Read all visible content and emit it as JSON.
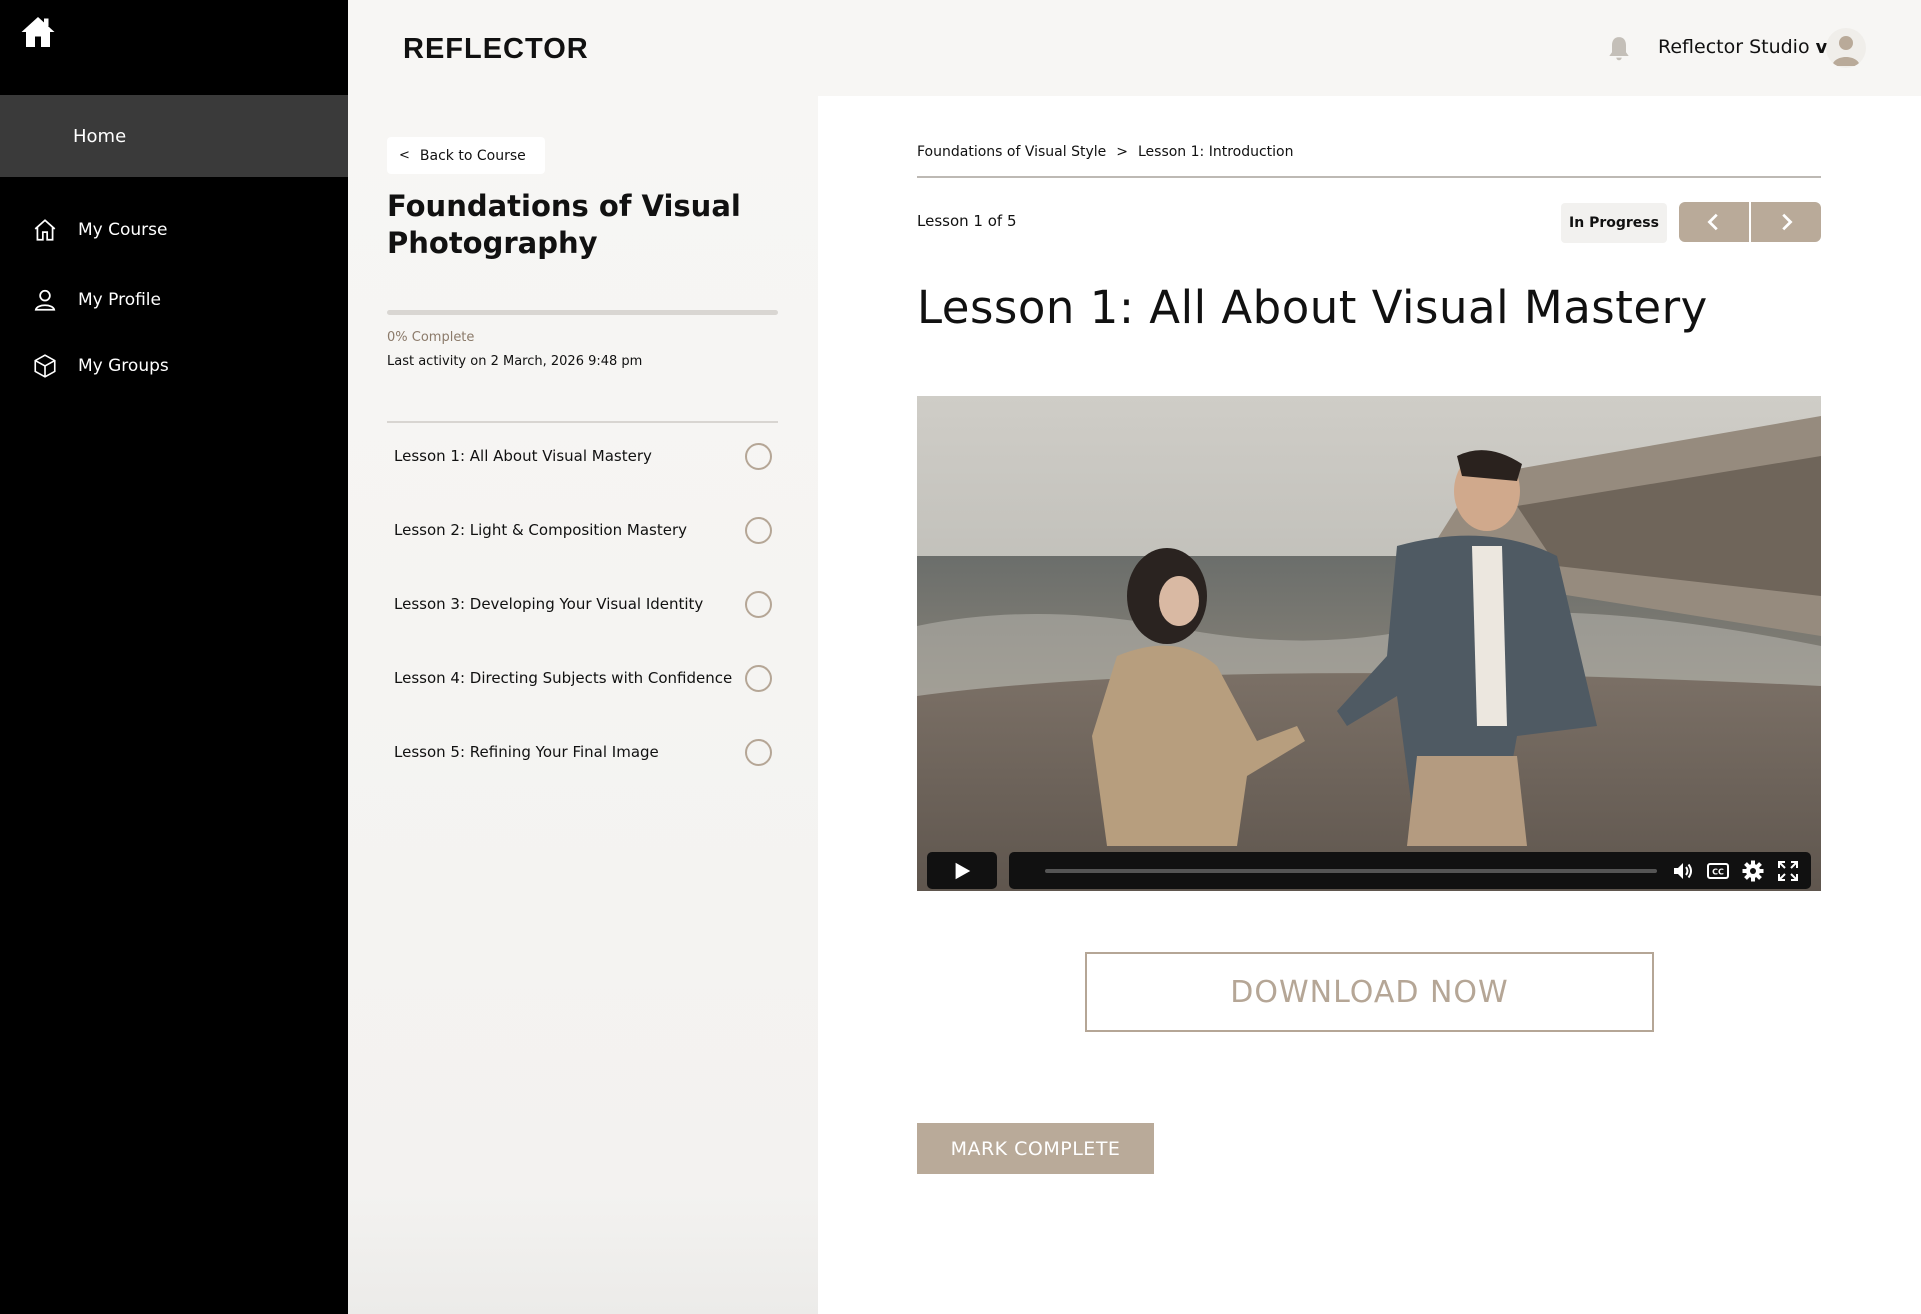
{
  "sidebar": {
    "logo_icon": "home-icon",
    "home_label": "Home",
    "items": [
      {
        "label": "My Course",
        "icon": "home-outline-icon"
      },
      {
        "label": "My Profile",
        "icon": "user-icon"
      },
      {
        "label": "My Groups",
        "icon": "cube-icon"
      }
    ]
  },
  "header": {
    "brand": "REFLECTOR",
    "account_name": "Reflector Studio",
    "account_caret": "v"
  },
  "course": {
    "back_label": "Back to Course",
    "back_chevron": "<",
    "title": "Foundations of Visual Photography",
    "progress_fraction": 0,
    "progress_text": "0% Complete",
    "last_activity": "Last activity on 2 March, 2026 9:48 pm",
    "lessons": [
      "Lesson 1: All About Visual Mastery",
      "Lesson 2: Light & Composition Mastery",
      "Lesson 3: Developing Your Visual Identity",
      "Lesson 4: Directing Subjects with Confidence",
      "Lesson 5: Refining Your Final Image"
    ]
  },
  "main": {
    "breadcrumb": {
      "course": "Foundations of Visual Style",
      "separator": ">",
      "lesson": "Lesson 1: Introduction"
    },
    "lesson_count": "Lesson 1 of 5",
    "status": "In Progress",
    "title": "Lesson 1: All About Visual Mastery",
    "download_label": "DOWNLOAD NOW",
    "mark_complete_label": "MARK COMPLETE"
  },
  "colors": {
    "accent": "#b9aa99",
    "sidebar_bg": "#000000",
    "sidebar_active": "#3a3a3a",
    "panel_bg": "#f7f6f4"
  }
}
